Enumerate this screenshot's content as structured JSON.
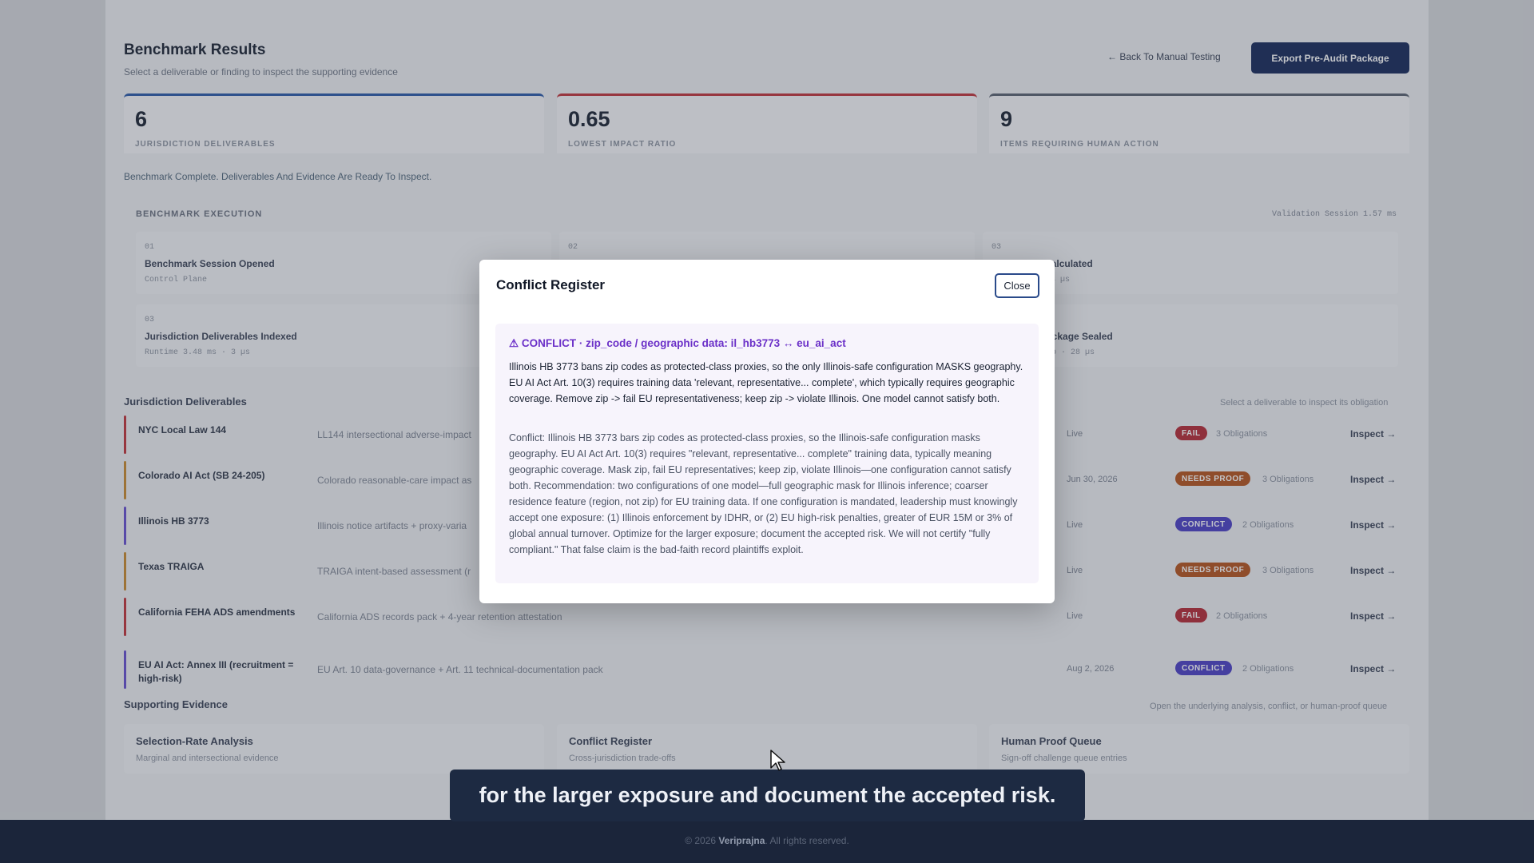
{
  "header": {
    "title": "Benchmark Results",
    "subtitle": "Select a deliverable or finding to inspect the supporting evidence",
    "back_link": "← Back To Manual Testing",
    "export_button": "Export Pre-Audit Package"
  },
  "stats": [
    {
      "value": "6",
      "label": "JURISDICTION DELIVERABLES",
      "accent": "#2a5aa8"
    },
    {
      "value": "0.65",
      "label": "LOWEST IMPACT RATIO",
      "accent": "#c0333a"
    },
    {
      "value": "9",
      "label": "ITEMS REQUIRING HUMAN ACTION",
      "accent": "#5a6270"
    }
  ],
  "status_line": "Benchmark Complete. Deliverables And Evidence Are Ready To Inspect.",
  "execution": {
    "label": "BENCHMARK EXECUTION",
    "meta": "Validation Session 1.57 ms",
    "steps": [
      {
        "step": "01",
        "name": "Benchmark Session Opened",
        "meta": "Control Plane"
      },
      {
        "step": "02",
        "name": "",
        "meta": ""
      },
      {
        "step": "03",
        "name": "mark Calculated",
        "meta": "ms · 4 µs"
      },
      {
        "step": "03",
        "name": "Jurisdiction Deliverables Indexed",
        "meta": "Runtime 3.48 ms · 3 µs"
      },
      {
        "step": "",
        "name": "ackage Sealed",
        "meta": "lp · 28 µs"
      }
    ]
  },
  "deliverables": {
    "title": "Jurisdiction Deliverables",
    "hint": "Select a deliverable to inspect its obligation",
    "inspect_label": "Inspect →",
    "rows": [
      {
        "name": "NYC Local Law 144",
        "desc": "LL144 intersectional adverse-impact",
        "date": "Live",
        "badge": "FAIL",
        "badge_color": "#b52a35",
        "bar_color": "#c0333a",
        "obligations": "3 Obligations"
      },
      {
        "name": "Colorado AI Act (SB 24-205)",
        "desc": "Colorado reasonable-care impact as",
        "date": "Jun 30, 2026",
        "badge": "NEEDS PROOF",
        "badge_color": "#b5531e",
        "bar_color": "#c98a2e",
        "obligations": "3 Obligations"
      },
      {
        "name": "Illinois HB 3773",
        "desc": "Illinois notice artifacts + proxy-varia",
        "date": "Live",
        "badge": "CONFLICT",
        "badge_color": "#4b3fc4",
        "bar_color": "#6650d0",
        "obligations": "2 Obligations"
      },
      {
        "name": "Texas TRAIGA",
        "desc": "TRAIGA intent-based assessment (r",
        "date": "Live",
        "badge": "NEEDS PROOF",
        "badge_color": "#b5531e",
        "bar_color": "#c98a2e",
        "obligations": "3 Obligations"
      },
      {
        "name": "California FEHA ADS amendments",
        "desc": "California ADS records pack + 4-year retention attestation",
        "date": "Live",
        "badge": "FAIL",
        "badge_color": "#b52a35",
        "bar_color": "#c0333a",
        "obligations": "2 Obligations"
      },
      {
        "name": "EU AI Act: Annex III (recruitment = high-risk)",
        "desc": "EU Art. 10 data-governance + Art. 11 technical-documentation pack",
        "date": "Aug 2, 2026",
        "badge": "CONFLICT",
        "badge_color": "#4b3fc4",
        "bar_color": "#6650d0",
        "obligations": "2 Obligations"
      }
    ]
  },
  "evidence": {
    "title": "Supporting Evidence",
    "hint": "Open the underlying analysis, conflict, or human-proof queue",
    "cards": [
      {
        "title": "Selection-Rate Analysis",
        "sub": "Marginal and intersectional evidence"
      },
      {
        "title": "Conflict Register",
        "sub": "Cross-jurisdiction trade-offs"
      },
      {
        "title": "Human Proof Queue",
        "sub": "Sign-off challenge queue entries"
      }
    ]
  },
  "modal": {
    "title": "Conflict Register",
    "close_label": "Close",
    "conflict_heading": "⚠ CONFLICT · zip_code / geographic data: il_hb3773 ↔ eu_ai_act",
    "summary": "Illinois HB 3773 bans zip codes as protected-class proxies, so the only Illinois-safe configuration MASKS geography. EU AI Act Art. 10(3) requires training data 'relevant, representative... complete', which typically requires geographic coverage. Remove zip -> fail EU representativeness; keep zip -> violate Illinois. One model cannot satisfy both.",
    "detail": "Conflict: Illinois HB 3773 bars zip codes as protected-class proxies, so the Illinois-safe configuration masks geography. EU AI Act Art. 10(3) requires \"relevant, representative... complete\" training data, typically meaning geographic coverage. Mask zip, fail EU representatives; keep zip, violate Illinois—one configuration cannot satisfy both. Recommendation: two configurations of one model—full geographic mask for Illinois inference; coarser residence feature (region, not zip) for EU training data. If one configuration is mandated, leadership must knowingly accept one exposure: (1) Illinois enforcement by IDHR, or (2) EU high-risk penalties, greater of EUR 15M or 3% of global annual turnover. Optimize for the larger exposure; document the accepted risk. We will not certify \"fully compliant.\" That false claim is the bad-faith record plaintiffs exploit."
  },
  "caption": "for the larger exposure and document the accepted risk.",
  "footer": {
    "prefix": "© 2026 ",
    "brand": "Veriprajna",
    "suffix": ". All rights reserved."
  }
}
